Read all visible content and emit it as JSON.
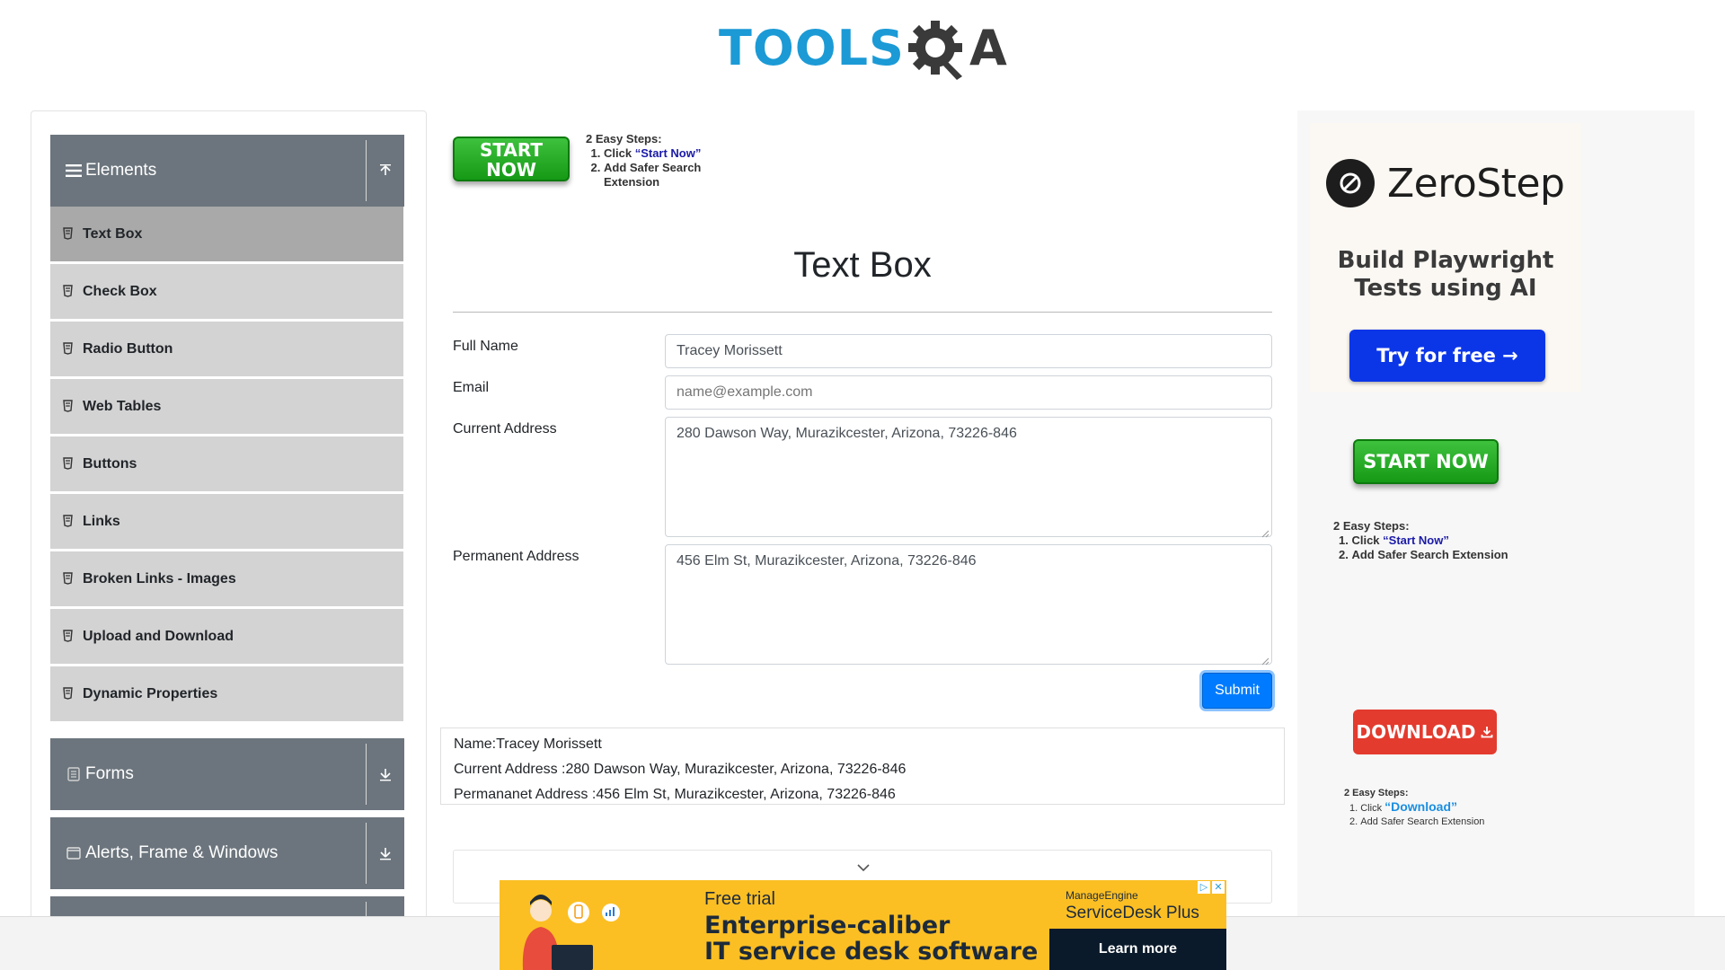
{
  "logo": {
    "text": "TOOLS",
    "qa": "A"
  },
  "sidebar": {
    "elements_header": "Elements",
    "items": [
      {
        "label": "Text Box"
      },
      {
        "label": "Check Box"
      },
      {
        "label": "Radio Button"
      },
      {
        "label": "Web Tables"
      },
      {
        "label": "Buttons"
      },
      {
        "label": "Links"
      },
      {
        "label": "Broken Links - Images"
      },
      {
        "label": "Upload and Download"
      },
      {
        "label": "Dynamic Properties"
      }
    ],
    "forms_header": "Forms",
    "alerts_header": "Alerts, Frame & Windows"
  },
  "top_ad": {
    "button": "START NOW",
    "steps_title": "2 Easy Steps:",
    "step1_prefix": "Click ",
    "step1_link": "“Start Now”",
    "step2": "Add Safer Search Extension"
  },
  "page": {
    "title": "Text Box"
  },
  "form": {
    "full_name_label": "Full Name",
    "full_name_value": "Tracey Morissett",
    "email_label": "Email",
    "email_placeholder": "name@example.com",
    "current_address_label": "Current Address",
    "current_address_value": "280 Dawson Way, Murazikcester, Arizona, 73226-846",
    "permanent_address_label": "Permanent Address",
    "permanent_address_value": "456 Elm St, Murazikcester, Arizona, 73226-846",
    "submit_label": "Submit"
  },
  "output": {
    "name": "Name:Tracey Morissett",
    "current_address": "Current Address :280 Dawson Way, Murazikcester, Arizona, 73226-846",
    "permanent_address": "Permananet Address :456 Elm St, Murazikcester, Arizona, 73226-846"
  },
  "right_ad": {
    "brand": "ZeroStep",
    "tagline_1": "Build Playwright",
    "tagline_2": "Tests using AI",
    "cta": "Try for free →",
    "start_button": "START NOW",
    "steps_title": "2 Easy Steps:",
    "step1_prefix": "Click ",
    "step1_link": "“Start Now”",
    "step2": "Add Safer Search Extension",
    "download_button": "DOWNLOAD",
    "dl_steps_title": "2 Easy Steps:",
    "dl_step1_prefix": "Click ",
    "dl_step1_link": "“Download”",
    "dl_step2": "Add Safer Search Extension"
  },
  "banner": {
    "free_trial": "Free trial",
    "headline_1": "Enterprise-caliber",
    "headline_2": "IT service desk software",
    "brand": "ManageEngine",
    "product": "ServiceDesk Plus",
    "cta": "Learn more"
  },
  "colors": {
    "sidebar_header": "#6c757d",
    "sidebar_item": "#d3d3d3",
    "sidebar_item_active": "#a9a9a9",
    "submit": "#007bff",
    "logo_blue": "#1b9ad6",
    "banner_bg": "#fbbf24"
  }
}
